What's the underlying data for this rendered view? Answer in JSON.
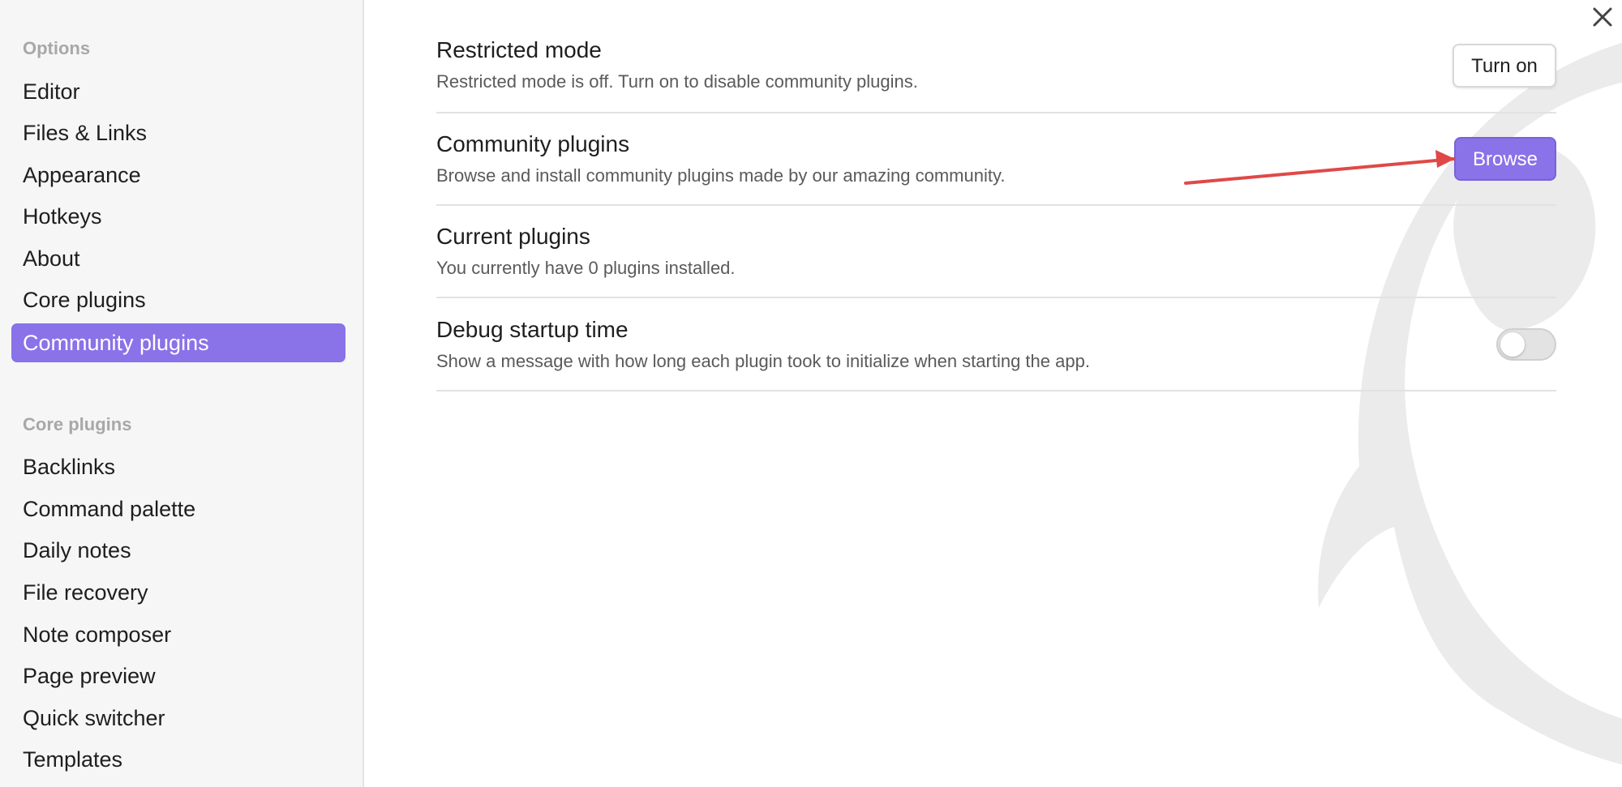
{
  "sidebar": {
    "options_header": "Options",
    "options_items": [
      {
        "label": "Editor"
      },
      {
        "label": "Files & Links"
      },
      {
        "label": "Appearance"
      },
      {
        "label": "Hotkeys"
      },
      {
        "label": "About"
      },
      {
        "label": "Core plugins"
      },
      {
        "label": "Community plugins",
        "active": true
      }
    ],
    "core_header": "Core plugins",
    "core_items": [
      {
        "label": "Backlinks"
      },
      {
        "label": "Command palette"
      },
      {
        "label": "Daily notes"
      },
      {
        "label": "File recovery"
      },
      {
        "label": "Note composer"
      },
      {
        "label": "Page preview"
      },
      {
        "label": "Quick switcher"
      },
      {
        "label": "Templates"
      }
    ]
  },
  "main": {
    "close_icon": "close-icon",
    "settings": [
      {
        "name": "Restricted mode",
        "description": "Restricted mode is off. Turn on to disable community plugins.",
        "control": "button",
        "control_label": "Turn on"
      },
      {
        "name": "Community plugins",
        "description": "Browse and install community plugins made by our amazing community.",
        "control": "button",
        "control_label": "Browse"
      },
      {
        "name": "Current plugins",
        "description": "You currently have 0 plugins installed."
      },
      {
        "name": "Debug startup time",
        "description": "Show a message with how long each plugin took to initialize when starting the app.",
        "control": "toggle",
        "toggle_on": false
      }
    ]
  },
  "colors": {
    "accent": "#8a72e8",
    "sidebar_bg": "#f6f6f6",
    "annotation_arrow": "#e04848"
  }
}
